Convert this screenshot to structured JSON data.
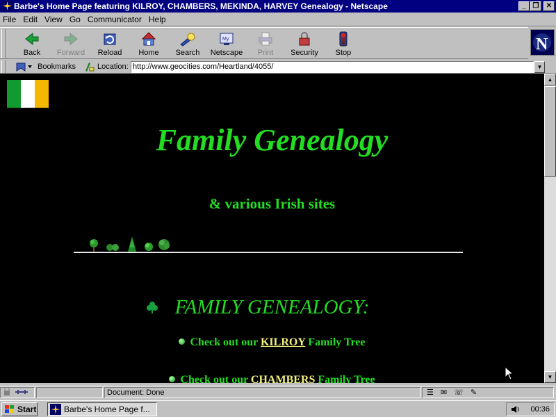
{
  "window": {
    "title": "Barbe's Home Page featuring KILROY, CHAMBERS, MEKINDA, HARVEY Genealogy - Netscape",
    "controls": [
      "_",
      "❐",
      "✕"
    ]
  },
  "menu": [
    {
      "label": "File"
    },
    {
      "label": "Edit"
    },
    {
      "label": "View"
    },
    {
      "label": "Go"
    },
    {
      "label": "Communicator"
    },
    {
      "label": "Help"
    }
  ],
  "toolbar": [
    {
      "label": "Back",
      "icon": "back-arrow-icon",
      "enabled": true
    },
    {
      "label": "Forward",
      "icon": "forward-arrow-icon",
      "enabled": false
    },
    {
      "label": "Reload",
      "icon": "reload-icon",
      "enabled": true
    },
    {
      "label": "Home",
      "icon": "home-icon",
      "enabled": true
    },
    {
      "label": "Search",
      "icon": "search-flashlight-icon",
      "enabled": true
    },
    {
      "label": "Netscape",
      "icon": "my-netscape-icon",
      "enabled": true
    },
    {
      "label": "Print",
      "icon": "printer-icon",
      "enabled": false
    },
    {
      "label": "Security",
      "icon": "padlock-icon",
      "enabled": true
    },
    {
      "label": "Stop",
      "icon": "stop-traffic-light-icon",
      "enabled": true
    }
  ],
  "location": {
    "bookmarks_label": "Bookmarks",
    "location_label": "Location:",
    "url": "http://www.geocities.com/Heartland/4055/"
  },
  "page": {
    "bg_color": "#000000",
    "text_color": "#22dd22",
    "link_color": "#f0f080",
    "flag_colors": [
      "#109a30",
      "#ffffff",
      "#f5b800"
    ],
    "heading": "Family Genealogy",
    "subheading": "& various Irish sites",
    "section_title": "FAMILY GENEALOGY:",
    "items": [
      {
        "prefix": "Check out our ",
        "link": "KILROY",
        "suffix": " Family Tree"
      },
      {
        "prefix": "Check out our ",
        "link": "CHAMBERS",
        "suffix": " Family Tree"
      }
    ]
  },
  "status": {
    "text": "Document: Done"
  },
  "taskbar": {
    "start_label": "Start",
    "task_label": "Barbe's Home Page f...",
    "clock": "00:36"
  }
}
